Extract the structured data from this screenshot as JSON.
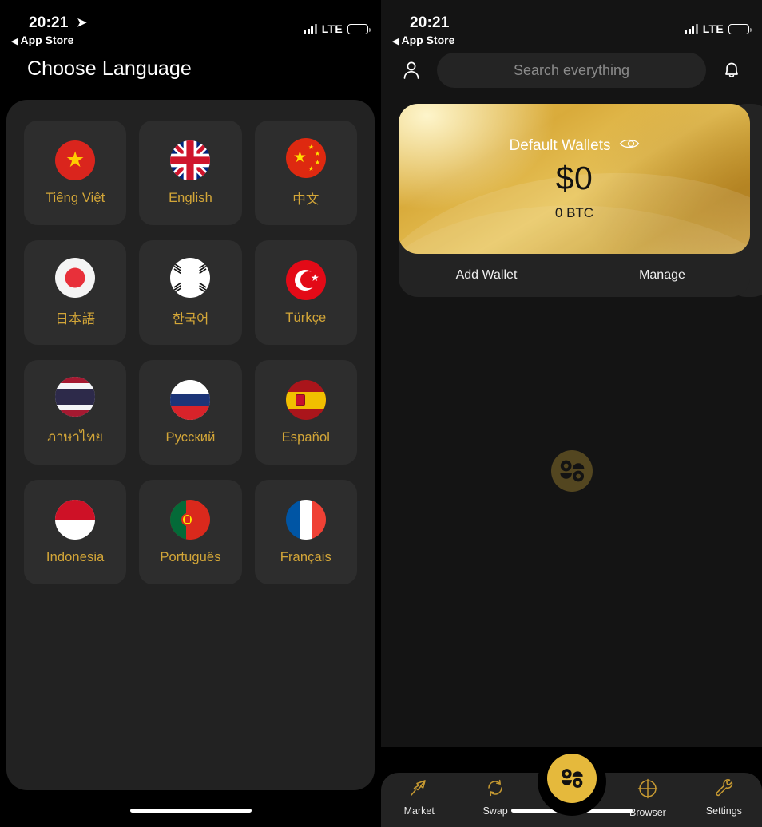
{
  "left_screen": {
    "status_bar": {
      "time": "20:21",
      "back_label": "App Store",
      "network": "LTE",
      "location_icon": "location-arrow-icon",
      "battery_icon": "battery-low-icon"
    },
    "page_title": "Choose Language",
    "languages": [
      {
        "label": "Tiếng Việt",
        "flag": "flag-vietnam"
      },
      {
        "label": "English",
        "flag": "flag-united-kingdom"
      },
      {
        "label": "中文",
        "flag": "flag-china"
      },
      {
        "label": "日本語",
        "flag": "flag-japan"
      },
      {
        "label": "한국어",
        "flag": "flag-south-korea"
      },
      {
        "label": "Türkçe",
        "flag": "flag-turkey"
      },
      {
        "label": "ภาษาไทย",
        "flag": "flag-thailand"
      },
      {
        "label": "Русский",
        "flag": "flag-russia"
      },
      {
        "label": "Español",
        "flag": "flag-spain"
      },
      {
        "label": "Indonesia",
        "flag": "flag-indonesia"
      },
      {
        "label": "Português",
        "flag": "flag-portugal"
      },
      {
        "label": "Français",
        "flag": "flag-france"
      }
    ]
  },
  "right_screen": {
    "status_bar": {
      "time": "20:21",
      "back_label": "App Store",
      "network": "LTE",
      "battery_icon": "battery-low-icon"
    },
    "header": {
      "profile_icon": "person-icon",
      "notification_icon": "bell-icon",
      "search_placeholder": "Search everything"
    },
    "wallet_card": {
      "name": "Default Wallets",
      "visibility_icon": "eye-icon",
      "fiat_balance": "$0",
      "crypto_balance": "0 BTC",
      "actions": [
        {
          "label": "Add Wallet"
        },
        {
          "label": "Manage"
        }
      ]
    },
    "watermark_icon": "app-logo-icon",
    "tab_bar": {
      "center_button_icon": "app-logo-icon",
      "tabs": [
        {
          "label": "Market",
          "icon": "lightning-arrow-icon"
        },
        {
          "label": "Swap",
          "icon": "swap-circular-arrows-icon"
        },
        {
          "label": "Browser",
          "icon": "crosshair-globe-icon"
        },
        {
          "label": "Settings",
          "icon": "wrench-icon"
        }
      ]
    }
  },
  "colors": {
    "accent_gold": "#D3A638",
    "card_gold": "#E0B444",
    "panel_bg": "#222222",
    "tile_bg": "#2D2D2D",
    "screen_bg": "#141414",
    "battery_yellow": "#F2C230"
  }
}
